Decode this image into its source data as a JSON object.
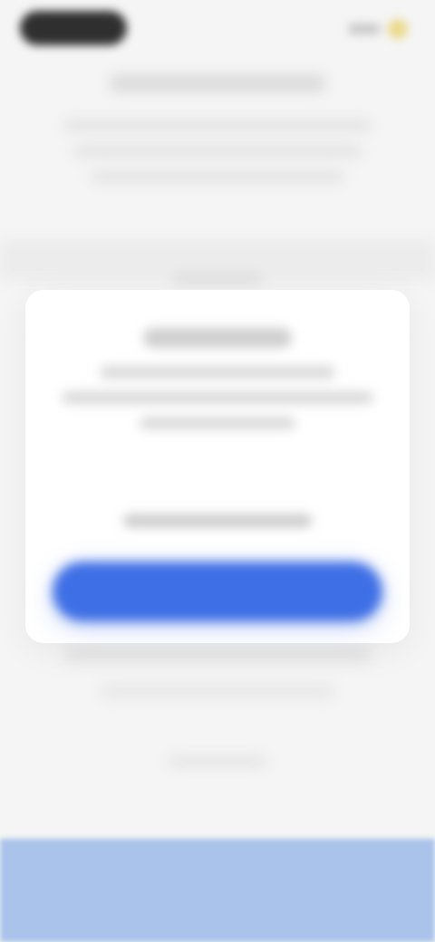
{
  "status_bar": {
    "time": "",
    "colors": {
      "pill": "#2f2f2f",
      "battery": "#e9d98a"
    },
    "icons": [
      "signal-icon",
      "battery-icon"
    ]
  },
  "background": {
    "title": "",
    "blurred": true
  },
  "modal": {
    "title": "",
    "body": [
      "",
      "",
      ""
    ],
    "link_text": "",
    "primary_button_label": "",
    "colors": {
      "primary": "#3e6fe6",
      "surface": "#ffffff"
    }
  },
  "bottom_panel": {
    "color": "#a9c3ea"
  }
}
